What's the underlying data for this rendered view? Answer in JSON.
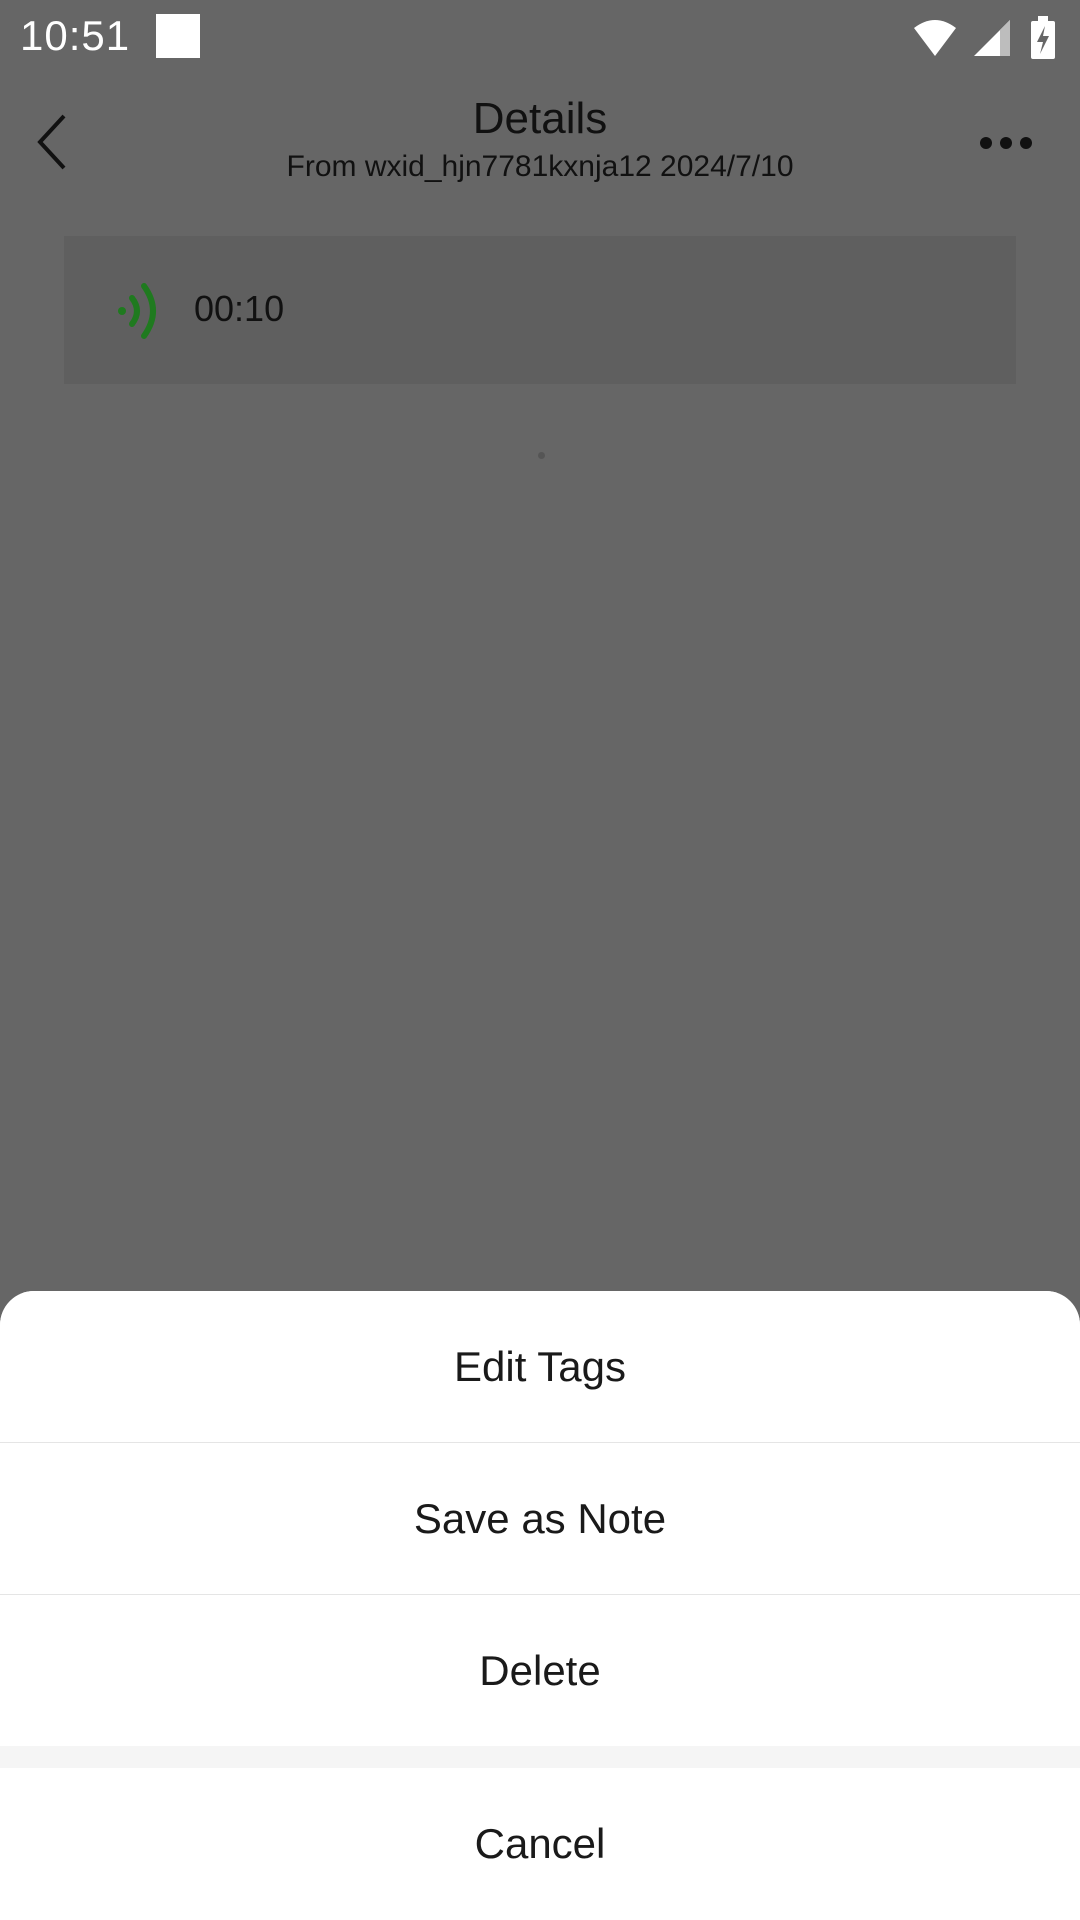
{
  "status_bar": {
    "time": "10:51",
    "icons": [
      "notification-square-icon",
      "wifi-icon",
      "cell-signal-icon",
      "battery-charging-icon"
    ]
  },
  "header": {
    "title": "Details",
    "subtitle": "From wxid_hjn7781kxnja12 2024/7/10",
    "back_icon": "chevron-left-icon",
    "more_icon": "more-horizontal-icon"
  },
  "voice_message": {
    "icon": "voice-wave-icon",
    "duration": "00:10",
    "accent_color": "#1f7a1f"
  },
  "action_sheet": {
    "items": [
      {
        "label": "Edit Tags"
      },
      {
        "label": "Save as Note"
      },
      {
        "label": "Delete"
      }
    ],
    "cancel_label": "Cancel"
  },
  "colors": {
    "overlay": "#666666",
    "sheet_background": "#ffffff",
    "text_primary": "#1a1a1a"
  }
}
